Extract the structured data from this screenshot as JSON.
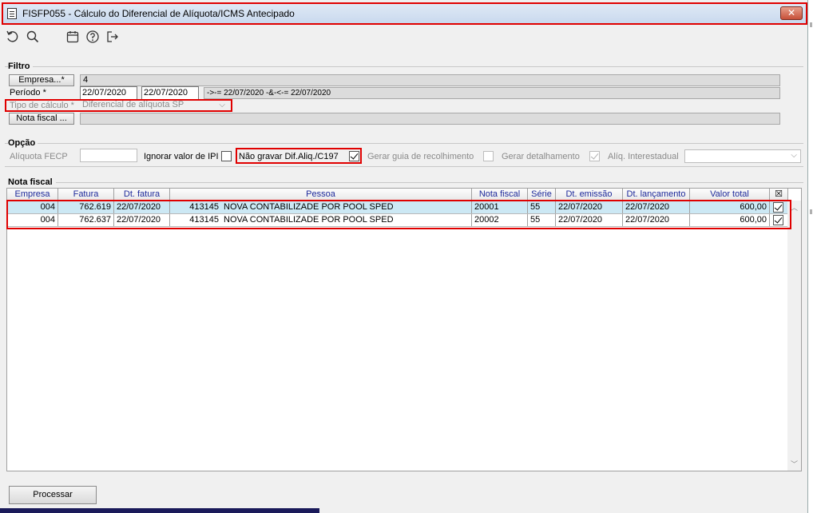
{
  "window": {
    "title": "FISFP055 - Cálculo do Diferencial de Alíquota/ICMS Antecipado",
    "close_label": "✕"
  },
  "toolbar": {
    "icons": [
      "undo-icon",
      "search-icon",
      "calendar-icon",
      "help-icon",
      "exit-icon"
    ]
  },
  "filtro": {
    "group_label": "Filtro",
    "empresa_button": "Empresa...*",
    "empresa_value": "4",
    "periodo_label": "Período *",
    "periodo_from": "22/07/2020",
    "periodo_to": "22/07/2020",
    "periodo_expr": "->-= 22/07/2020 -&-<-= 22/07/2020",
    "tipo_calculo_label": "Tipo de cálculo *",
    "tipo_calculo_value": "Diferencial de alíquota SP",
    "nota_fiscal_button": "Nota fiscal ..."
  },
  "opcao": {
    "group_label": "Opção",
    "aliquota_fecp_label": "Alíquota FECP",
    "ignorar_ipi_label": "Ignorar valor de IPI",
    "ignorar_ipi_checked": false,
    "nao_gravar_label": "Não gravar Dif.Aliq./C197",
    "nao_gravar_checked": true,
    "gerar_guia_label": "Gerar guia de recolhimento",
    "gerar_guia_checked": false,
    "gerar_detalhamento_label": "Gerar detalhamento",
    "gerar_detalhamento_checked": true,
    "aliq_interestadual_label": "Alíq. Interestadual"
  },
  "nota_fiscal": {
    "group_label": "Nota fiscal",
    "columns": [
      "Empresa",
      "Fatura",
      "Dt. fatura",
      "Pessoa",
      "Nota fiscal",
      "Série",
      "Dt. emissão",
      "Dt. lançamento",
      "Valor total",
      "☒"
    ],
    "rows": [
      {
        "empresa": "004",
        "fatura": "762.619",
        "dt_fatura": "22/07/2020",
        "pessoa_cod": "413145",
        "pessoa_nome": "NOVA CONTABILIZADE POR POOL SPED",
        "nota_fiscal": "20001",
        "serie": "55",
        "dt_emissao": "22/07/2020",
        "dt_lancamento": "22/07/2020",
        "valor_total": "600,00",
        "checked": true
      },
      {
        "empresa": "004",
        "fatura": "762.637",
        "dt_fatura": "22/07/2020",
        "pessoa_cod": "413145",
        "pessoa_nome": "NOVA CONTABILIZADE POR POOL SPED",
        "nota_fiscal": "20002",
        "serie": "55",
        "dt_emissao": "22/07/2020",
        "dt_lancamento": "22/07/2020",
        "valor_total": "600,00",
        "checked": true
      }
    ]
  },
  "footer": {
    "processar_label": "Processar"
  }
}
